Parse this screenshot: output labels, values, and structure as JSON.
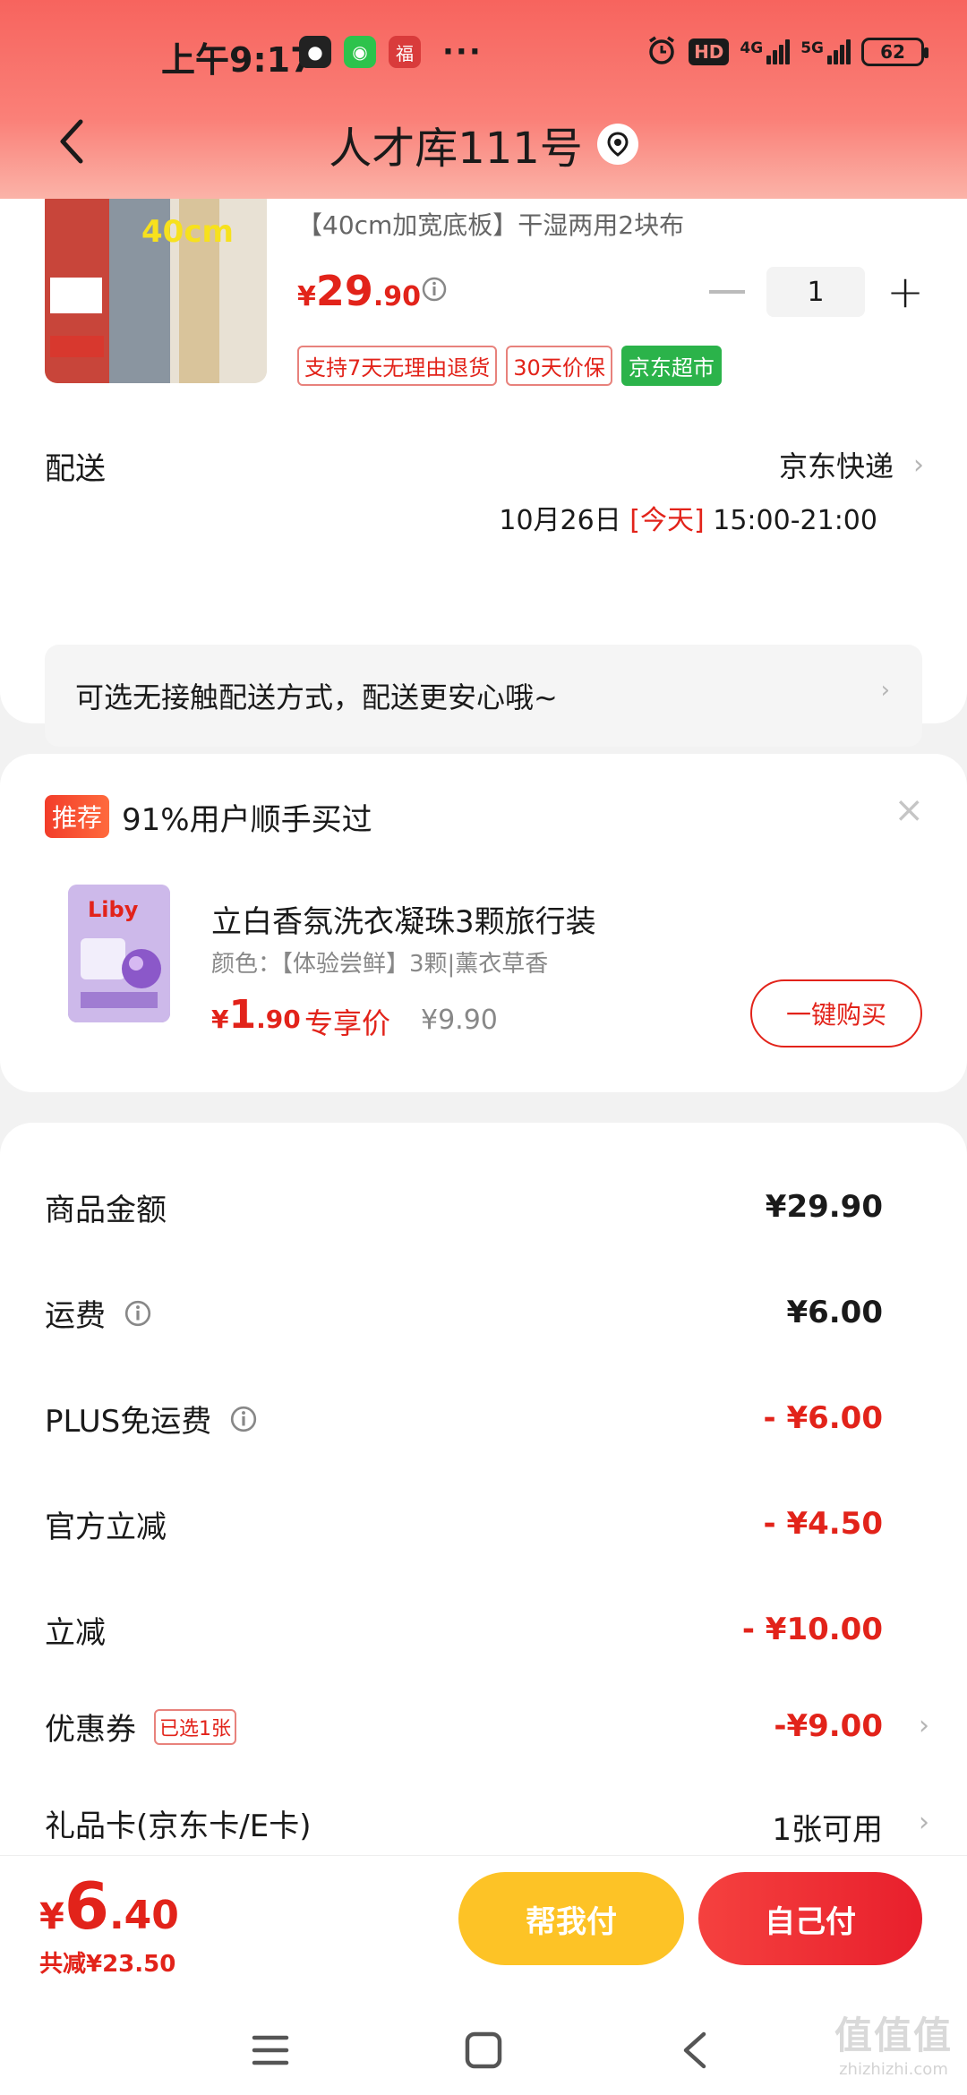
{
  "status_bar": {
    "time": "上午9:17",
    "more": "···",
    "hd": "HD",
    "net1": "4G",
    "net2": "5G",
    "battery": "62"
  },
  "nav": {
    "title": "人才库111号"
  },
  "product": {
    "image_badge": "40cm",
    "desc": "【40cm加宽底板】干湿两用2块布",
    "price_currency": "¥",
    "price_int": "29",
    "price_dec": ".90",
    "quantity": "1",
    "tags": [
      "支持7天无理由退货",
      "30天价保",
      "京东超市"
    ]
  },
  "delivery": {
    "label": "配送",
    "method": "京东快递",
    "date": "10月26日",
    "today": "[今天]",
    "time": "15:00-21:00",
    "contactless": "可选无接触配送方式，配送更安心哦~"
  },
  "recommend": {
    "badge": "推荐",
    "title": "91%用户顺手买过",
    "close": "×",
    "image_brand": "Liby",
    "name": "立白香氛洗衣凝珠3颗旅行装",
    "spec": "颜色：【体验尝鲜】3颗|薰衣草香",
    "price_currency": "¥",
    "price_int": "1",
    "price_dec": ".90",
    "exclusive": "专享价",
    "original": "¥9.90",
    "buy_label": "一键购买"
  },
  "breakdown": {
    "goods_label": "商品金额",
    "goods_value": "¥29.90",
    "freight_label": "运费",
    "freight_value": "¥6.00",
    "plus_label": "PLUS免运费",
    "plus_value": "- ¥6.00",
    "official_label": "官方立减",
    "official_value": "- ¥4.50",
    "instant_label": "立减",
    "instant_value": "- ¥10.00",
    "coupon_label": "优惠券",
    "coupon_tag": "已选1张",
    "coupon_value": "-¥9.00",
    "giftcard_label": "礼品卡(京东卡/E卡)",
    "giftcard_value": "1张可用"
  },
  "bottom": {
    "total_currency": "¥",
    "total_int": "6",
    "total_dec": ".40",
    "saved": "共减¥23.50",
    "help_pay": "帮我付",
    "self_pay": "自己付"
  },
  "watermark": {
    "logo": "值值值",
    "url": "zhizhizhi.com"
  },
  "colors": {
    "accent_red": "#e2231a",
    "help_yellow": "#fdc326",
    "jd_green": "#2bb34a"
  }
}
